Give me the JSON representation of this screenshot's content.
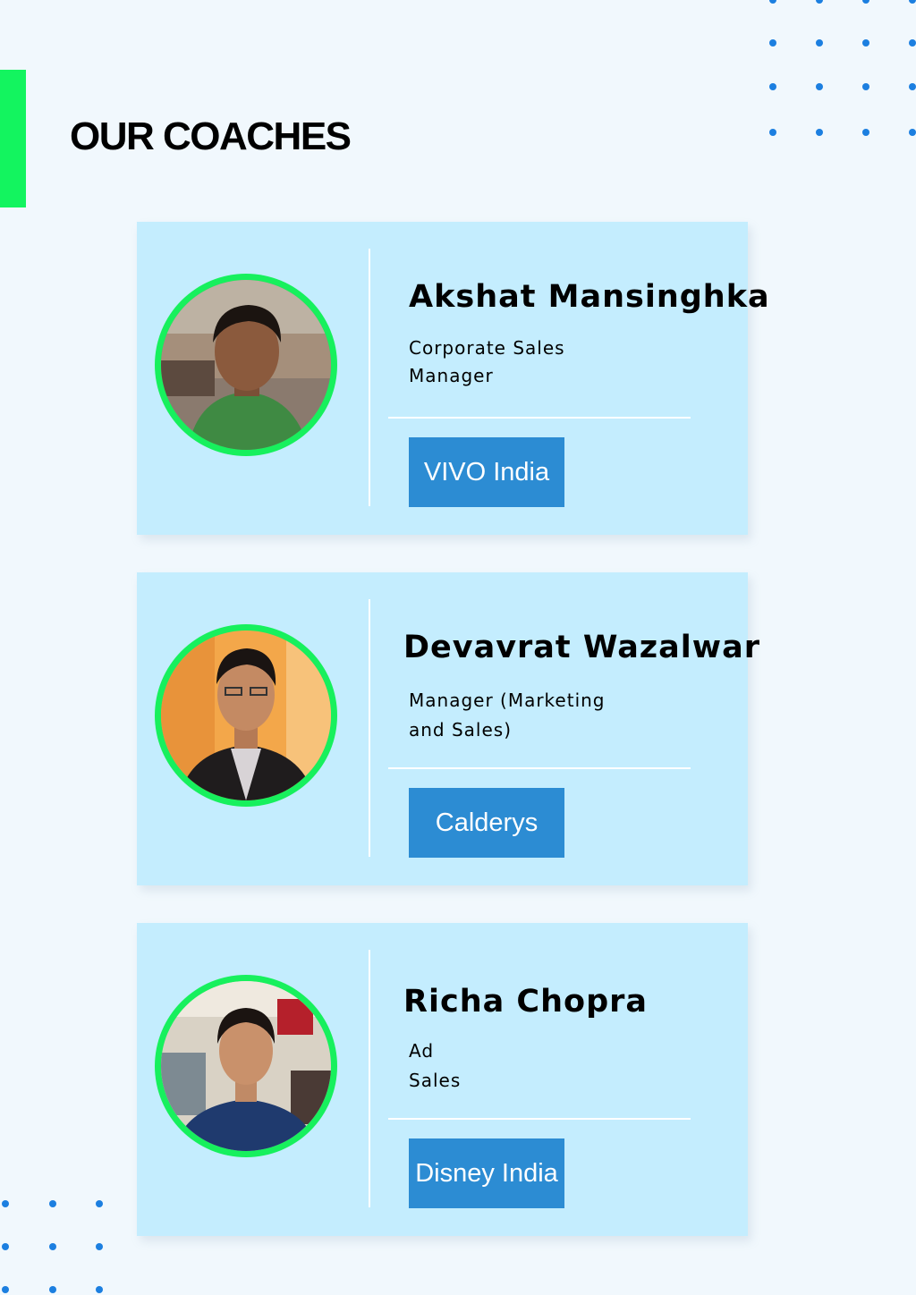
{
  "page": {
    "heading": "OUR COACHES"
  },
  "colors": {
    "accent": "#13f45f",
    "card_bg": "#c4edfe",
    "company_bg": "#2c8cd3",
    "dot": "#1c7fe0"
  },
  "coaches": [
    {
      "name": "Akshat Mansinghka",
      "role_lines": [
        "Corporate Sales",
        "Manager"
      ],
      "company": "VIVO India"
    },
    {
      "name": "Devavrat Wazalwar",
      "role_lines": [
        "Manager (Marketing",
        "and Sales)"
      ],
      "company": "Calderys"
    },
    {
      "name": "Richa Chopra",
      "role_lines": [
        "Ad",
        "Sales"
      ],
      "company": "Disney India"
    }
  ]
}
